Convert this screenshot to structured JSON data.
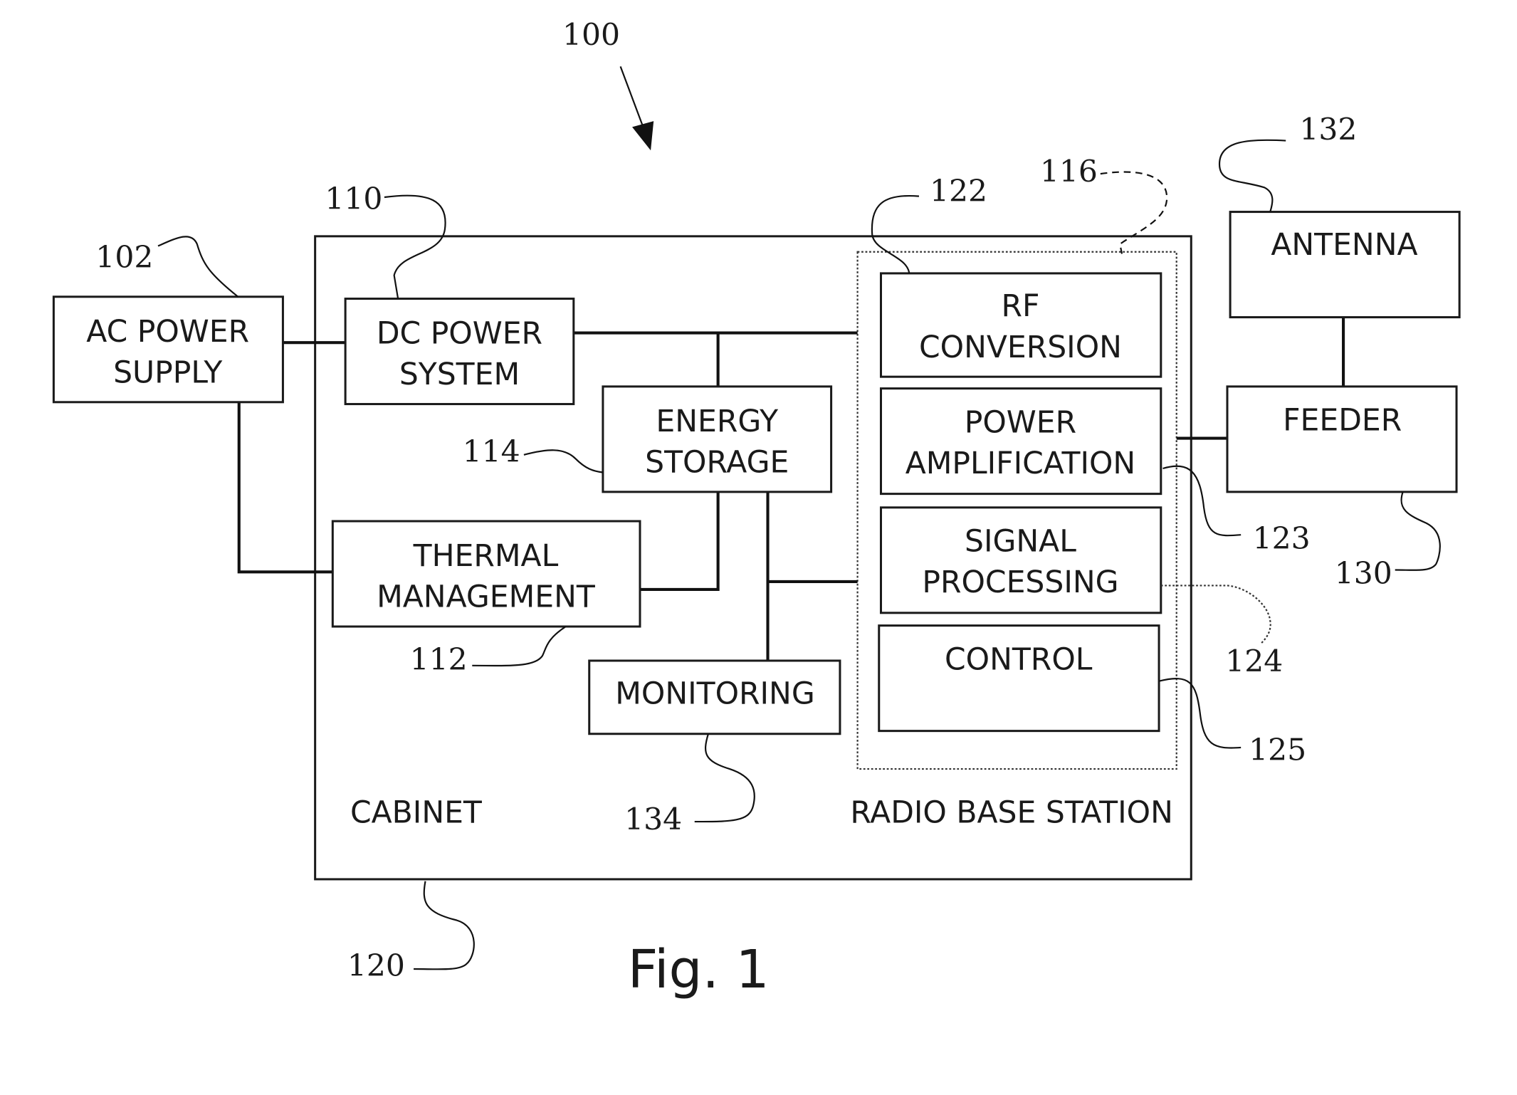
{
  "figure": {
    "caption": "Fig. 1",
    "reference": "100"
  },
  "blocks": {
    "ac_power_supply": {
      "line1": "AC POWER",
      "line2": "SUPPLY",
      "ref": "102"
    },
    "dc_power_system": {
      "line1": "DC POWER",
      "line2": "SYSTEM",
      "ref": "110"
    },
    "energy_storage": {
      "line1": "ENERGY",
      "line2": "STORAGE",
      "ref": "114"
    },
    "thermal_management": {
      "line1": "THERMAL",
      "line2": "MANAGEMENT",
      "ref": "112"
    },
    "monitoring": {
      "line1": "MONITORING",
      "ref": "134"
    },
    "rf_conversion": {
      "line1": "RF",
      "line2": "CONVERSION",
      "ref": "122"
    },
    "power_amplification": {
      "line1": "POWER",
      "line2": "AMPLIFICATION",
      "ref": "123"
    },
    "signal_processing": {
      "line1": "SIGNAL",
      "line2": "PROCESSING",
      "ref": "124"
    },
    "control": {
      "line1": "CONTROL",
      "ref": "125"
    },
    "antenna": {
      "line1": "ANTENNA",
      "ref": "132"
    },
    "feeder": {
      "line1": "FEEDER",
      "ref": "130"
    }
  },
  "containers": {
    "cabinet": {
      "label": "CABINET",
      "ref": "120"
    },
    "radio_base_station": {
      "label": "RADIO BASE STATION",
      "ref": "116"
    }
  }
}
